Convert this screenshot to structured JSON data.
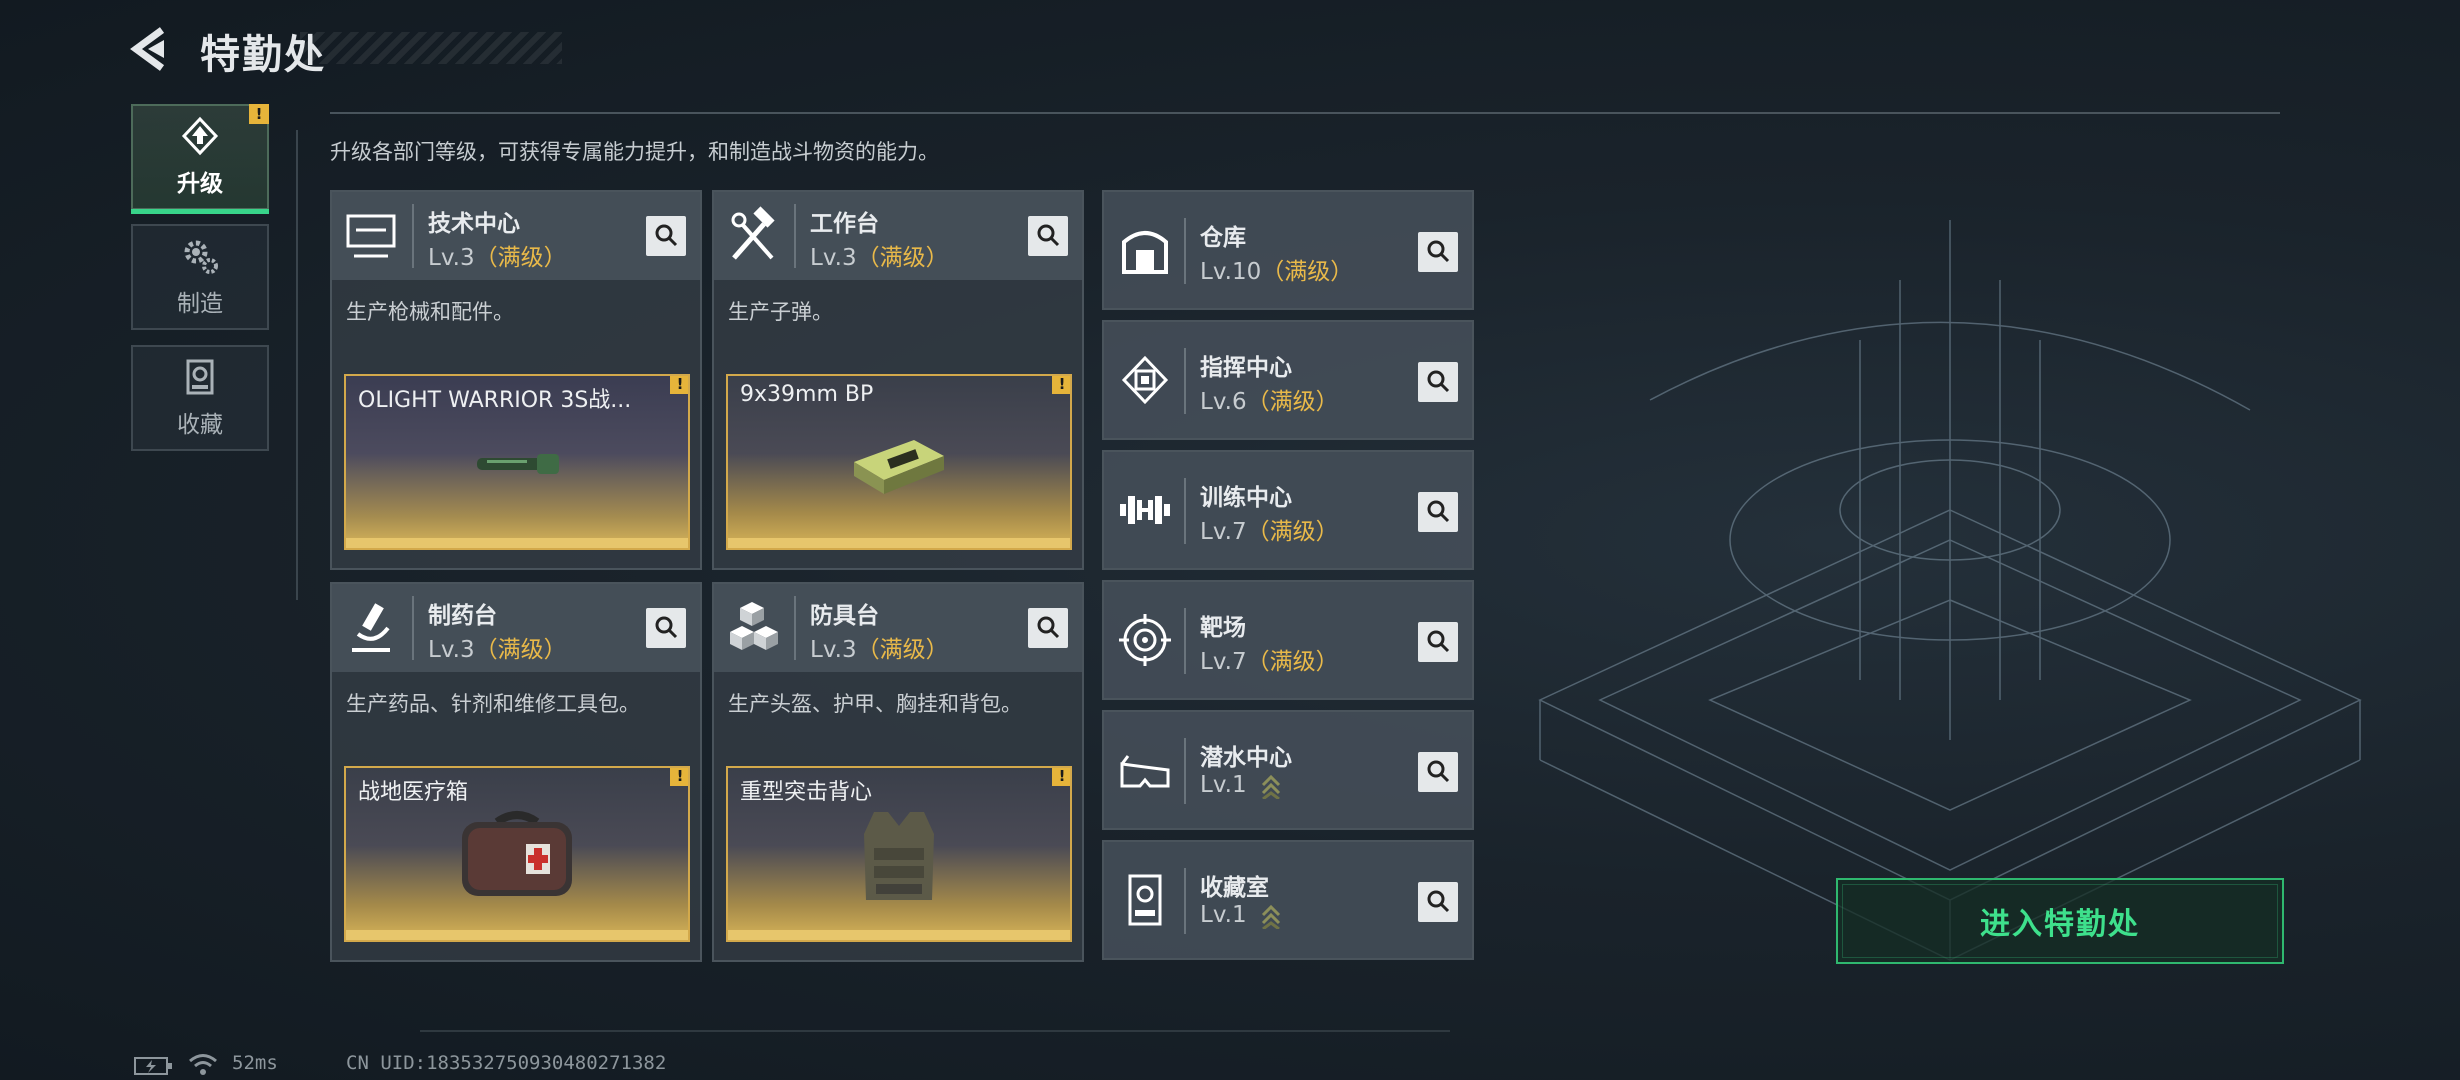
{
  "header": {
    "title": "特勤处"
  },
  "nav": [
    {
      "label": "升级",
      "icon": "upgrade-icon",
      "active": true,
      "warning": "!"
    },
    {
      "label": "制造",
      "icon": "gears-icon",
      "active": false
    },
    {
      "label": "收藏",
      "icon": "collection-icon",
      "active": false
    }
  ],
  "description": "升级各部门等级，可获得专属能力提升，和制造战斗物资的能力。",
  "departments": [
    {
      "name": "技术中心",
      "level": "Lv.3",
      "status": "（满级）",
      "desc": "生产枪械和配件。",
      "product": "OLIGHT WARRIOR 3S战...",
      "warning": "!",
      "icon": "computer-icon",
      "product_icon": "flashlight-icon"
    },
    {
      "name": "工作台",
      "level": "Lv.3",
      "status": "（满级）",
      "desc": "生产子弹。",
      "product": "9x39mm BP",
      "warning": "!",
      "icon": "hammer-wrench-icon",
      "product_icon": "ammo-box-icon"
    },
    {
      "name": "制药台",
      "level": "Lv.3",
      "status": "（满级）",
      "desc": "生产药品、针剂和维修工具包。",
      "product": "战地医疗箱",
      "warning": "!",
      "icon": "microscope-icon",
      "product_icon": "medkit-icon"
    },
    {
      "name": "防具台",
      "level": "Lv.3",
      "status": "（满级）",
      "desc": "生产头盔、护甲、胸挂和背包。",
      "product": "重型突击背心",
      "warning": "!",
      "icon": "armor-boxes-icon",
      "product_icon": "vest-icon"
    }
  ],
  "facilities": [
    {
      "name": "仓库",
      "level": "Lv.10",
      "status": "（满级）",
      "icon": "warehouse-icon"
    },
    {
      "name": "指挥中心",
      "level": "Lv.6",
      "status": "（满级）",
      "icon": "chip-icon"
    },
    {
      "name": "训练中心",
      "level": "Lv.7",
      "status": "（满级）",
      "icon": "dumbbell-icon"
    },
    {
      "name": "靶场",
      "level": "Lv.7",
      "status": "（满级）",
      "icon": "target-icon"
    },
    {
      "name": "潜水中心",
      "level": "Lv.1",
      "status": "",
      "upgradable": true,
      "icon": "diving-goggles-icon"
    },
    {
      "name": "收藏室",
      "level": "Lv.1",
      "status": "",
      "upgradable": true,
      "icon": "trophy-room-icon"
    }
  ],
  "enter_button": "进入特勤处",
  "status_bar": {
    "ping": "52ms",
    "uid": "CN UID:18353275093048027​1382"
  },
  "colors": {
    "accent": "#38d48a",
    "max_level": "#e9b949",
    "warning": "#e6b43a"
  }
}
